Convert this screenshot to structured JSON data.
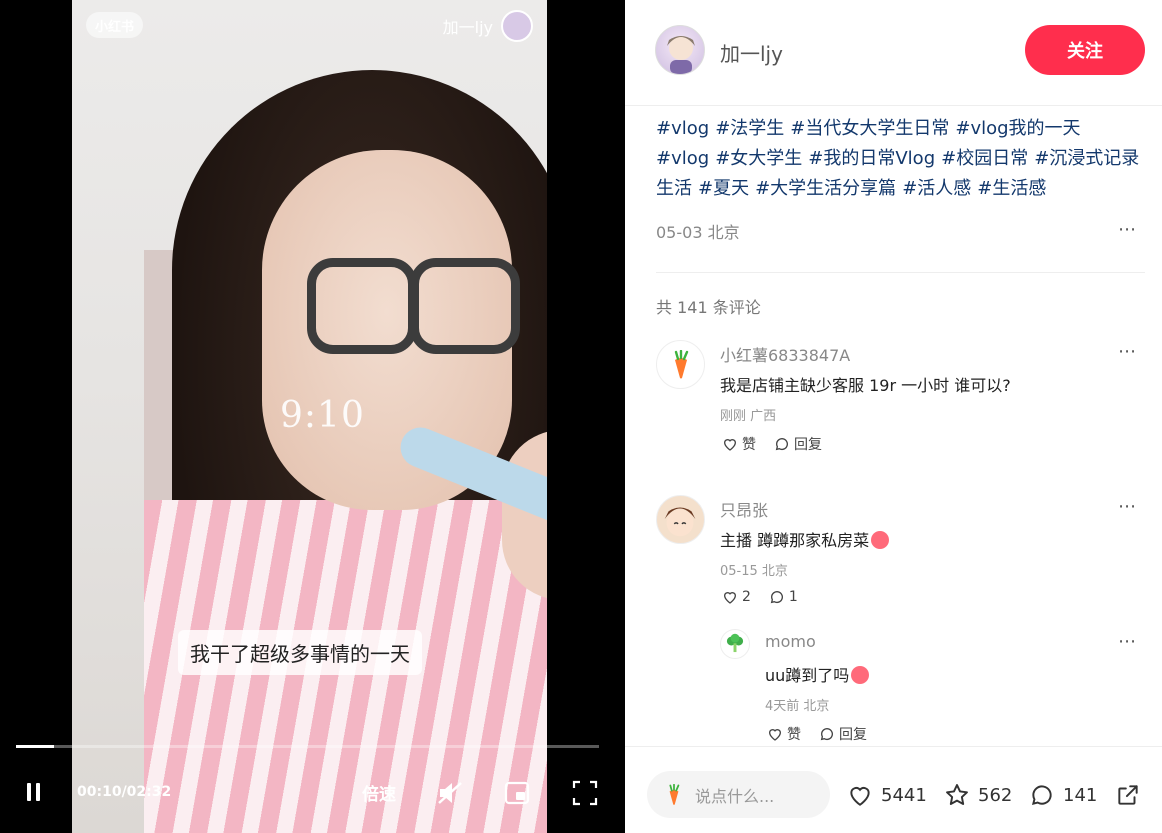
{
  "video": {
    "logo": "小红书",
    "author": "加一ljy",
    "overlay_time": "9:10",
    "subtitle": "我干了超级多事情的一天",
    "current_time": "00:10/02:32",
    "progress": 0.066,
    "speed_label": "倍速"
  },
  "author": {
    "name": "加一ljy",
    "follow_label": "关注"
  },
  "post": {
    "tags": [
      "#vlog",
      "#法学生",
      "#当代女大学生日常",
      "#vlog我的一天",
      "#vlog",
      "#女大学生",
      "#我的日常Vlog",
      "#校园日常",
      "#沉浸式记录生活",
      "#夏天",
      "#大学生活分享篇",
      "#活人感",
      "#生活感"
    ],
    "meta": "05-03 北京",
    "comment_count": "共 141 条评论"
  },
  "comments": [
    {
      "name": "小红薯6833847A",
      "text": "我是店铺主缺少客服 19r 一小时 谁可以?",
      "meta": "刚刚 广西",
      "like": "赞",
      "reply": "回复"
    },
    {
      "name": "只昂张",
      "text": "主播 蹲蹲那家私房菜",
      "meta": "05-15 北京",
      "like": "2",
      "reply": "1"
    },
    {
      "name": "momo",
      "text": "uu蹲到了吗",
      "meta": "4天前 北京",
      "like": "赞",
      "reply": "回复"
    }
  ],
  "bottom": {
    "input_placeholder": "说点什么...",
    "likes": "5441",
    "stars": "562",
    "comments": "141"
  },
  "colors": {
    "accent": "#ff2e4d",
    "tag": "#13386c"
  }
}
